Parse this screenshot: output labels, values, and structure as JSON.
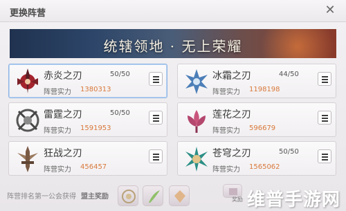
{
  "dialog": {
    "title": "更换阵营",
    "banner_text": "统辖领地 · 无上荣耀"
  },
  "factions": [
    {
      "name": "赤炎之刃",
      "members": "50/50",
      "strength_label": "阵营实力",
      "strength": "1380313",
      "emblem": "crimson-blade-emblem-icon",
      "color": "#a4242d"
    },
    {
      "name": "冰霜之刃",
      "members": "44/50",
      "strength_label": "阵营实力",
      "strength": "1198198",
      "emblem": "frost-blade-emblem-icon",
      "color": "#3f6fa8"
    },
    {
      "name": "雷霆之刃",
      "members": "50/50",
      "strength_label": "阵营实力",
      "strength": "1591953",
      "emblem": "thunder-blade-emblem-icon",
      "color": "#5a5a5a"
    },
    {
      "name": "莲花之刃",
      "members": "",
      "strength_label": "阵营实力",
      "strength": "596679",
      "emblem": "lotus-blade-emblem-icon",
      "color": "#b4476d"
    },
    {
      "name": "狂战之刃",
      "members": "",
      "strength_label": "阵营实力",
      "strength": "456457",
      "emblem": "berserker-blade-emblem-icon",
      "color": "#7a5a44"
    },
    {
      "name": "苍穹之刃",
      "members": "50/50",
      "strength_label": "阵营实力",
      "strength": "1565062",
      "emblem": "sky-blade-emblem-icon",
      "color": "#2d8f86"
    }
  ],
  "footer": {
    "text": "阵营排名第一公会获得",
    "strong": "盟主奖励",
    "reward_label": "奖励"
  },
  "watermark": "维普手游网"
}
